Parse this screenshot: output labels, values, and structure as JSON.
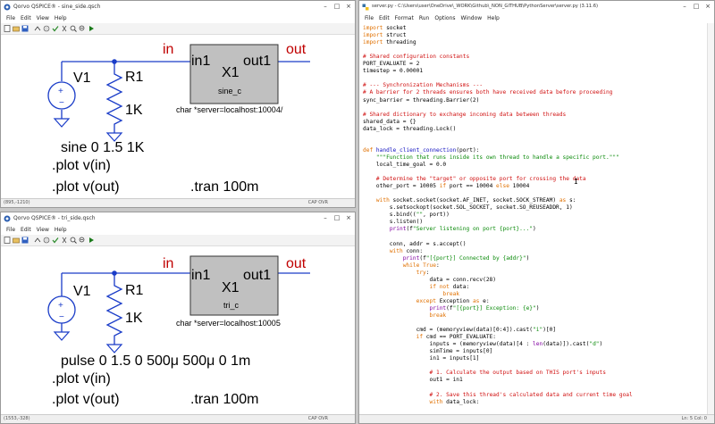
{
  "top_window": {
    "title": "Qorvo QSPICE® - sine_side.qsch",
    "menu": [
      "File",
      "Edit",
      "View",
      "Help"
    ],
    "status_left": "(895,-1210)",
    "status_right": "CAP OVR",
    "schematic": {
      "v_label": "V1",
      "r_label": "R1",
      "r_value": "1K",
      "in_port": "in",
      "out_port": "out",
      "block_pin_in": "in1",
      "block_pin_out": "out1",
      "block_name": "X1",
      "block_type": "sine_c",
      "block_attr": "char *server=localhost:10004/",
      "source_spec": "sine 0 1.5 1K",
      "plot_in": ".plot v(in)",
      "plot_out": ".plot v(out)",
      "tran": ".tran 100m"
    }
  },
  "bottom_window": {
    "title": "Qorvo QSPICE® - tri_side.qsch",
    "menu": [
      "File",
      "Edit",
      "View",
      "Help"
    ],
    "status_left": "(1553,-328)",
    "status_right": "CAP OVR",
    "schematic": {
      "v_label": "V1",
      "r_label": "R1",
      "r_value": "1K",
      "in_port": "in",
      "out_port": "out",
      "block_pin_in": "in1",
      "block_pin_out": "out1",
      "block_name": "X1",
      "block_type": "tri_c",
      "block_attr": "char *server=localhost:10005",
      "source_spec": "pulse 0 1.5 0 500μ 500μ 0 1m",
      "plot_in": ".plot v(in)",
      "plot_out": ".plot v(out)",
      "tran": ".tran 100m"
    }
  },
  "editor_window": {
    "title": "server.py - C:\\Users\\user\\OneDrive\\_WORK\\Github\\_NON_GITHUB\\PythonServer\\server.py (3.11.6)",
    "menu": [
      "File",
      "Edit",
      "Format",
      "Run",
      "Options",
      "Window",
      "Help"
    ],
    "status": "Ln: 5   Col: 0",
    "cursor_glyph": "I",
    "code": [
      [
        [
          "kw",
          "import"
        ],
        [
          "plain",
          " socket"
        ]
      ],
      [
        [
          "kw",
          "import"
        ],
        [
          "plain",
          " struct"
        ]
      ],
      [
        [
          "kw",
          "import"
        ],
        [
          "plain",
          " threading"
        ]
      ],
      [],
      [
        [
          "cm",
          "# Shared configuration constants"
        ]
      ],
      [
        [
          "plain",
          "PORT_EVALUATE = 2"
        ]
      ],
      [
        [
          "plain",
          "timestep = 0.00001"
        ]
      ],
      [],
      [
        [
          "cm",
          "# --- Synchronization Mechanisms ---"
        ]
      ],
      [
        [
          "cm",
          "# A barrier for 2 threads ensures both have received data before proceeding"
        ]
      ],
      [
        [
          "plain",
          "sync_barrier = threading.Barrier(2)"
        ]
      ],
      [],
      [
        [
          "cm",
          "# Shared dictionary to exchange incoming data between threads"
        ]
      ],
      [
        [
          "plain",
          "shared_data = {}"
        ]
      ],
      [
        [
          "plain",
          "data_lock = threading.Lock()"
        ]
      ],
      [],
      [],
      [
        [
          "kw",
          "def"
        ],
        [
          "plain",
          " "
        ],
        [
          "df",
          "handle_client_connection"
        ],
        [
          "plain",
          "(port):"
        ]
      ],
      [
        [
          "plain",
          "    "
        ],
        [
          "st",
          "\"\"\"Function that runs inside its own thread to handle a specific port.\"\"\""
        ]
      ],
      [
        [
          "plain",
          "    local_time_goal = 0.0"
        ]
      ],
      [],
      [
        [
          "plain",
          "    "
        ],
        [
          "cm",
          "# Determine the \"target\" or opposite port for crossing the data"
        ]
      ],
      [
        [
          "plain",
          "    other_port = 10005 "
        ],
        [
          "kw",
          "if"
        ],
        [
          "plain",
          " port == 10004 "
        ],
        [
          "kw",
          "else"
        ],
        [
          "plain",
          " 10004"
        ]
      ],
      [],
      [
        [
          "plain",
          "    "
        ],
        [
          "kw",
          "with"
        ],
        [
          "plain",
          " socket.socket(socket.AF_INET, socket.SOCK_STREAM) "
        ],
        [
          "kw",
          "as"
        ],
        [
          "plain",
          " s:"
        ]
      ],
      [
        [
          "plain",
          "        s.setsockopt(socket.SOL_SOCKET, socket.SO_REUSEADDR, 1)"
        ]
      ],
      [
        [
          "plain",
          "        s.bind(("
        ],
        [
          "st",
          "\"\""
        ],
        [
          "plain",
          ", port))"
        ]
      ],
      [
        [
          "plain",
          "        s.listen()"
        ]
      ],
      [
        [
          "plain",
          "        "
        ],
        [
          "bi",
          "print"
        ],
        [
          "plain",
          "(f"
        ],
        [
          "st",
          "\"Server listening on port {port}...\""
        ],
        [
          "plain",
          ")"
        ]
      ],
      [],
      [
        [
          "plain",
          "        conn, addr = s.accept()"
        ]
      ],
      [
        [
          "plain",
          "        "
        ],
        [
          "kw",
          "with"
        ],
        [
          "plain",
          " conn:"
        ]
      ],
      [
        [
          "plain",
          "            "
        ],
        [
          "bi",
          "print"
        ],
        [
          "plain",
          "(f"
        ],
        [
          "st",
          "\"[{port}] Connected by {addr}\""
        ],
        [
          "plain",
          ")"
        ]
      ],
      [
        [
          "plain",
          "            "
        ],
        [
          "kw",
          "while"
        ],
        [
          "plain",
          " "
        ],
        [
          "kw",
          "True"
        ],
        [
          "plain",
          ":"
        ]
      ],
      [
        [
          "plain",
          "                "
        ],
        [
          "kw",
          "try"
        ],
        [
          "plain",
          ":"
        ]
      ],
      [
        [
          "plain",
          "                    data = conn.recv(28)"
        ]
      ],
      [
        [
          "plain",
          "                    "
        ],
        [
          "kw",
          "if not"
        ],
        [
          "plain",
          " data:"
        ]
      ],
      [
        [
          "plain",
          "                        "
        ],
        [
          "kw",
          "break"
        ]
      ],
      [
        [
          "plain",
          "                "
        ],
        [
          "kw",
          "except"
        ],
        [
          "plain",
          " Exception "
        ],
        [
          "kw",
          "as"
        ],
        [
          "plain",
          " e:"
        ]
      ],
      [
        [
          "plain",
          "                    "
        ],
        [
          "bi",
          "print"
        ],
        [
          "plain",
          "(f"
        ],
        [
          "st",
          "\"[{port}] Exception: {e}\""
        ],
        [
          "plain",
          ")"
        ]
      ],
      [
        [
          "plain",
          "                    "
        ],
        [
          "kw",
          "break"
        ]
      ],
      [],
      [
        [
          "plain",
          "                cmd = (memoryview(data)[0:4]).cast("
        ],
        [
          "st",
          "\"i\""
        ],
        [
          "plain",
          ")[0]"
        ]
      ],
      [
        [
          "plain",
          "                "
        ],
        [
          "kw",
          "if"
        ],
        [
          "plain",
          " cmd == PORT_EVALUATE:"
        ]
      ],
      [
        [
          "plain",
          "                    inputs = (memoryview(data)[4 : "
        ],
        [
          "bi",
          "len"
        ],
        [
          "plain",
          "(data)]).cast("
        ],
        [
          "st",
          "\"d\""
        ],
        [
          "plain",
          ")"
        ]
      ],
      [
        [
          "plain",
          "                    simTime = inputs[0]"
        ]
      ],
      [
        [
          "plain",
          "                    in1 = inputs[1]"
        ]
      ],
      [],
      [
        [
          "plain",
          "                    "
        ],
        [
          "cm",
          "# 1. Calculate the output based on THIS port's inputs"
        ]
      ],
      [
        [
          "plain",
          "                    out1 = in1"
        ]
      ],
      [],
      [
        [
          "plain",
          "                    "
        ],
        [
          "cm",
          "# 2. Save this thread's calculated data and current time goal"
        ]
      ],
      [
        [
          "plain",
          "                    "
        ],
        [
          "kw",
          "with"
        ],
        [
          "plain",
          " data_lock:"
        ]
      ]
    ]
  }
}
